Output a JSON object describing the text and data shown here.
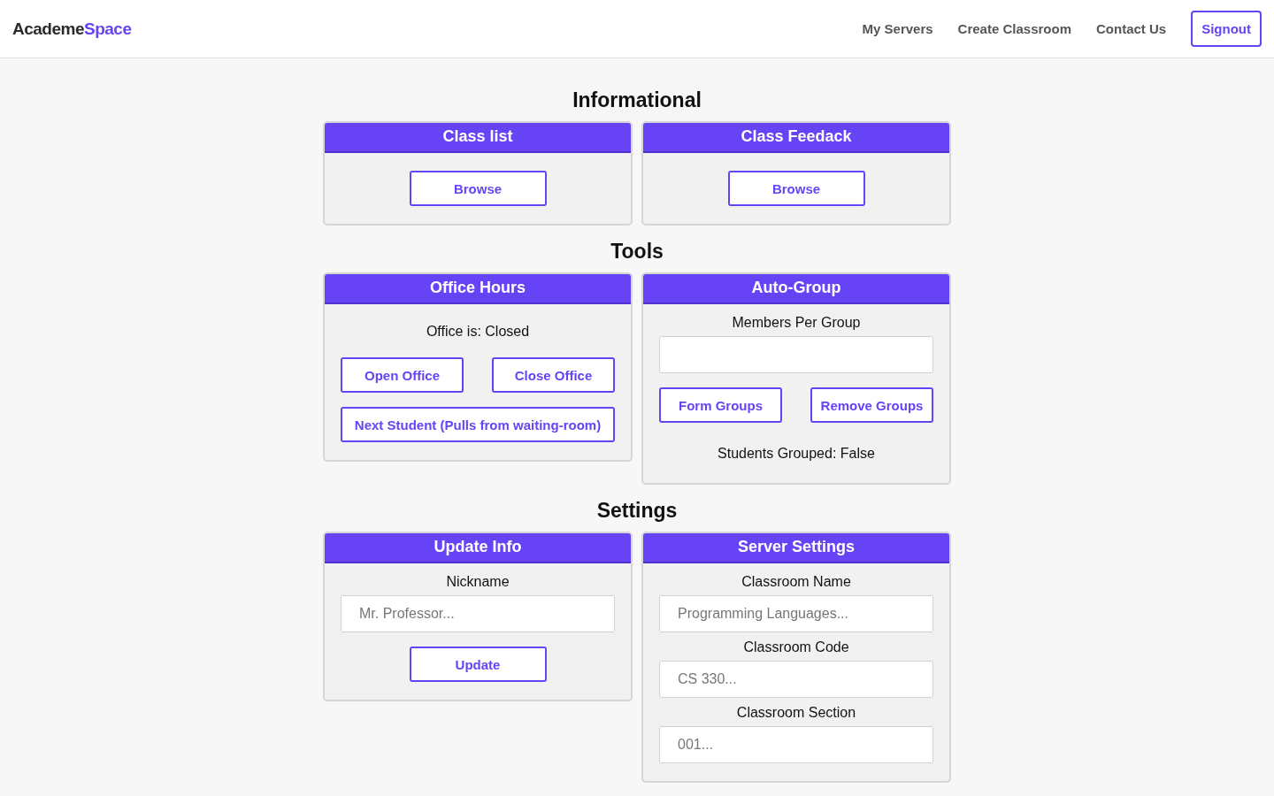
{
  "brand": {
    "name": "Academe",
    "accent": "Space"
  },
  "nav": {
    "links": [
      "My Servers",
      "Create Classroom",
      "Contact Us"
    ],
    "signout": "Signout"
  },
  "sections": [
    {
      "title": "Informational",
      "cards": [
        {
          "title": "Class list",
          "items": [
            {
              "kind": "button",
              "label": "Browse"
            }
          ]
        },
        {
          "title": "Class Feedack",
          "items": [
            {
              "kind": "button",
              "label": "Browse"
            }
          ]
        }
      ]
    },
    {
      "title": "Tools",
      "cards": [
        {
          "title": "Office Hours",
          "items": [
            {
              "kind": "text",
              "text": "Office is: Closed"
            },
            {
              "kind": "button_row",
              "labels": [
                "Open Office",
                "Close Office"
              ]
            },
            {
              "kind": "wide_button",
              "label": "Next Student (Pulls from waiting-room)"
            }
          ]
        },
        {
          "title": "Auto-Group",
          "items": [
            {
              "kind": "field",
              "label": "Members Per Group"
            },
            {
              "kind": "button_row",
              "labels": [
                "Form Groups",
                "Remove Groups"
              ]
            },
            {
              "kind": "text",
              "text": "Students Grouped: False"
            }
          ]
        }
      ]
    },
    {
      "title": "Settings",
      "cards": [
        {
          "title": "Update Info",
          "items": [
            {
              "kind": "field",
              "label": "Nickname",
              "placeholder": "Mr. Professor..."
            },
            {
              "kind": "button",
              "label": "Update"
            }
          ]
        },
        {
          "title": "Server Settings",
          "items": [
            {
              "kind": "field",
              "label": "Classroom Name",
              "placeholder": "Programming Languages..."
            },
            {
              "kind": "field",
              "label": "Classroom Code",
              "placeholder": "CS 330..."
            },
            {
              "kind": "field",
              "label": "Classroom Section",
              "placeholder": "001..."
            }
          ]
        }
      ]
    }
  ]
}
